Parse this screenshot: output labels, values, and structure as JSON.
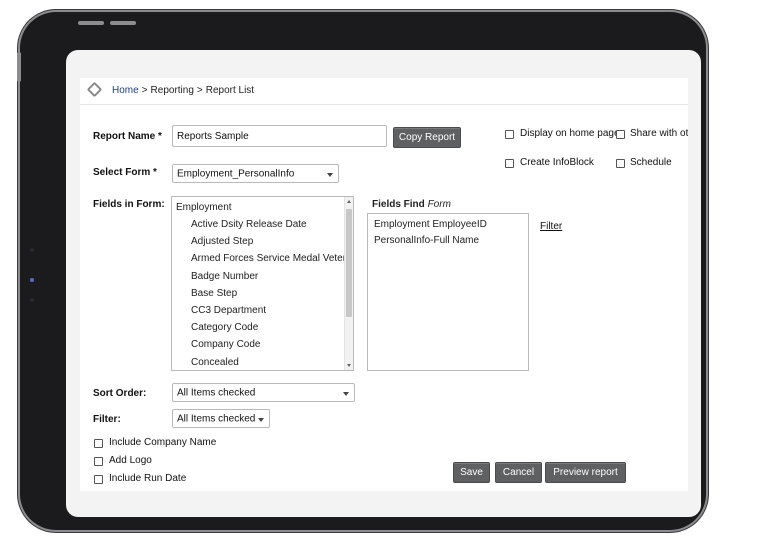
{
  "breadcrumb": {
    "home": "Home",
    "section": "Reporting",
    "page": "Report List",
    "separator": ">"
  },
  "report_name": {
    "label": "Report Name *",
    "value": "Reports Sample"
  },
  "copy_report_label": "Copy Report",
  "options": {
    "display_home": {
      "label": "Display on home page",
      "checked": false
    },
    "share_with": {
      "label": "Share with oth",
      "checked": false
    },
    "create_infoblock": {
      "label": "Create InfoBlock",
      "checked": false
    },
    "schedule": {
      "label": "Schedule",
      "checked": false
    }
  },
  "select_form": {
    "label": "Select Form *",
    "value": "Employment_PersonalInfo"
  },
  "fields_in_form": {
    "label": "Fields in Form:",
    "group": "Employment",
    "items": [
      "Active Dsity Release Date",
      "Adjusted Step",
      "Armed Forces Service Medal Vetera",
      "Badge Number",
      "Base Step",
      "CC3 Department",
      "Category Code",
      "Company Code",
      "Concealed"
    ]
  },
  "fields_find": {
    "title_bold": "Fields Find",
    "title_italic": "Form",
    "items": [
      "Employment EmployeeID",
      "PersonalInfo-Full Name"
    ],
    "filter_link": "Filter"
  },
  "sort_order": {
    "label": "Sort Order:",
    "value": "All Items checked"
  },
  "filter": {
    "label": "Filter:",
    "value": "All Items checked"
  },
  "include": {
    "company_name": {
      "label": "Include Company Name",
      "checked": false
    },
    "logo": {
      "label": "Add Logo",
      "checked": false
    },
    "run_date": {
      "label": "Include Run Date",
      "checked": false
    }
  },
  "actions": {
    "save": "Save",
    "cancel": "Cancel",
    "preview": "Preview report"
  },
  "colors": {
    "button_bg": "#5f6062",
    "link": "#1f3c88",
    "device_frame": "#1b1b1d"
  }
}
